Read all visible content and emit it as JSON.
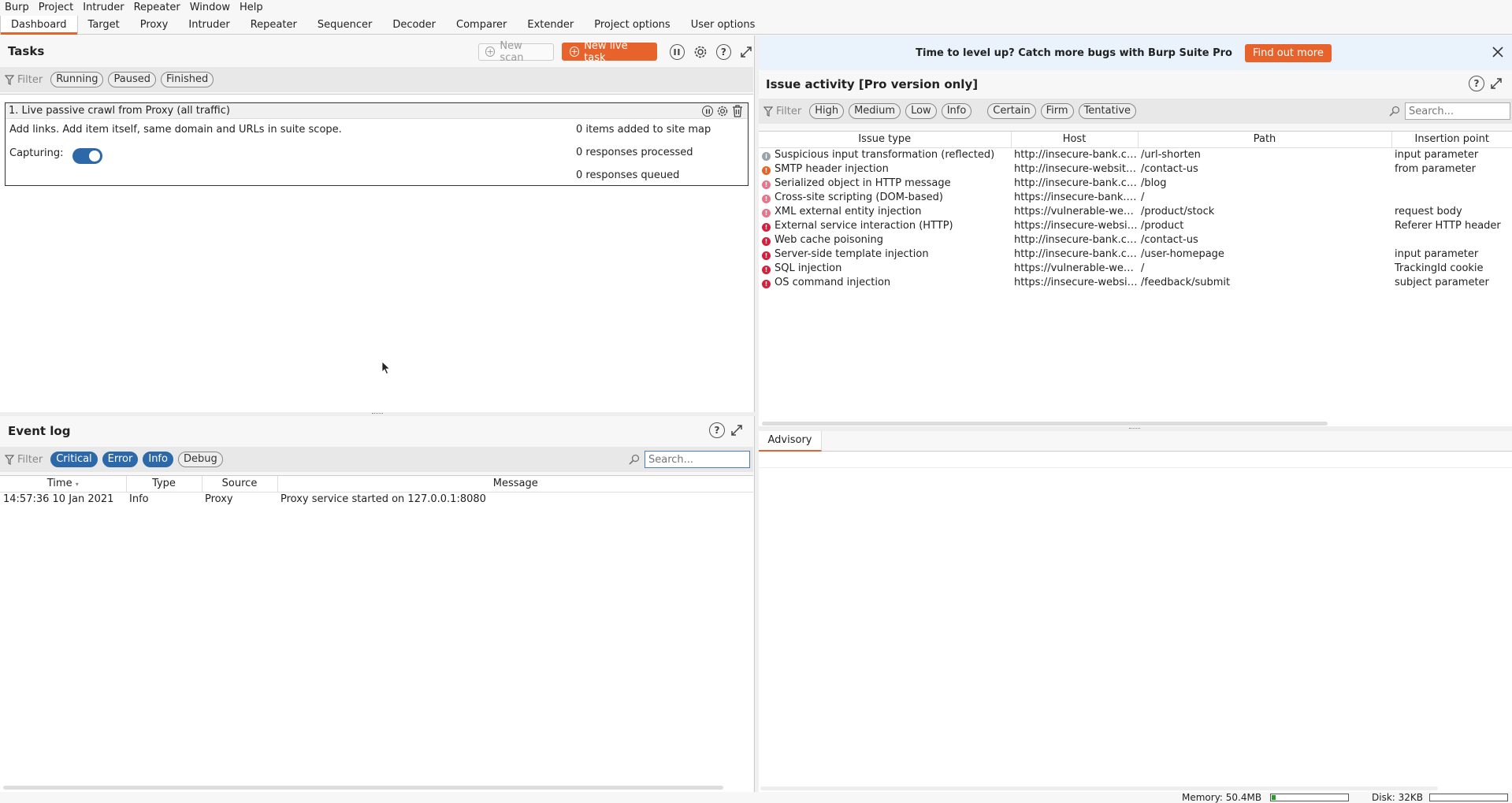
{
  "menu": [
    "Burp",
    "Project",
    "Intruder",
    "Repeater",
    "Window",
    "Help"
  ],
  "tabs": [
    "Dashboard",
    "Target",
    "Proxy",
    "Intruder",
    "Repeater",
    "Sequencer",
    "Decoder",
    "Comparer",
    "Extender",
    "Project options",
    "User options"
  ],
  "tasks": {
    "title": "Tasks",
    "new_scan": "New scan",
    "new_live_task": "New live task",
    "filter_label": "Filter",
    "filters": [
      "Running",
      "Paused",
      "Finished"
    ],
    "task": {
      "title": "1. Live passive crawl from Proxy (all traffic)",
      "description": "Add links. Add item itself, same domain and URLs in suite scope.",
      "capturing_label": "Capturing:",
      "stats": [
        "0 items added to site map",
        "0 responses processed",
        "0 responses queued"
      ]
    }
  },
  "event_log": {
    "title": "Event log",
    "filter_label": "Filter",
    "filters": [
      {
        "label": "Critical",
        "on": true
      },
      {
        "label": "Error",
        "on": true
      },
      {
        "label": "Info",
        "on": true
      },
      {
        "label": "Debug",
        "on": false
      }
    ],
    "search_placeholder": "Search...",
    "columns": [
      "Time",
      "Type",
      "Source",
      "Message"
    ],
    "rows": [
      {
        "time": "14:57:36 10 Jan 2021",
        "type": "Info",
        "source": "Proxy",
        "message": "Proxy service started on 127.0.0.1:8080"
      }
    ]
  },
  "banner": {
    "text": "Time to level up? Catch more bugs with Burp Suite Pro",
    "button": "Find out more"
  },
  "issues": {
    "title": "Issue activity [Pro version only]",
    "filter_label": "Filter",
    "severity_filters": [
      "High",
      "Medium",
      "Low",
      "Info"
    ],
    "confidence_filters": [
      "Certain",
      "Firm",
      "Tentative"
    ],
    "search_placeholder": "Search...",
    "columns": [
      "Issue type",
      "Host",
      "Path",
      "Insertion point"
    ],
    "rows": [
      {
        "severity": "info",
        "type": "Suspicious input transformation (reflected)",
        "host": "http://insecure-bank.com",
        "path": "/url-shorten",
        "insertion": "input parameter"
      },
      {
        "severity": "medium",
        "type": "SMTP header injection",
        "host": "http://insecure-website....",
        "path": "/contact-us",
        "insertion": "from parameter"
      },
      {
        "severity": "high-light",
        "type": "Serialized object in HTTP message",
        "host": "http://insecure-bank.com",
        "path": "/blog",
        "insertion": ""
      },
      {
        "severity": "high-light",
        "type": "Cross-site scripting (DOM-based)",
        "host": "https://insecure-bank.com",
        "path": "/",
        "insertion": ""
      },
      {
        "severity": "high-light",
        "type": "XML external entity injection",
        "host": "https://vulnerable-websi...",
        "path": "/product/stock",
        "insertion": "request body"
      },
      {
        "severity": "high",
        "type": "External service interaction (HTTP)",
        "host": "https://insecure-website...",
        "path": "/product",
        "insertion": "Referer HTTP header"
      },
      {
        "severity": "high",
        "type": "Web cache poisoning",
        "host": "http://insecure-bank.com",
        "path": "/contact-us",
        "insertion": ""
      },
      {
        "severity": "high",
        "type": "Server-side template injection",
        "host": "http://insecure-bank.com",
        "path": "/user-homepage",
        "insertion": "input parameter"
      },
      {
        "severity": "high",
        "type": "SQL injection",
        "host": "https://vulnerable-websi...",
        "path": "/",
        "insertion": "TrackingId cookie"
      },
      {
        "severity": "high",
        "type": "OS command injection",
        "host": "https://insecure-website...",
        "path": "/feedback/submit",
        "insertion": "subject parameter"
      }
    ]
  },
  "advisory_tab": "Advisory",
  "status": {
    "memory": "Memory: 50.4MB",
    "memory_fraction": 0.05,
    "disk": "Disk: 32KB",
    "disk_fraction": 0.0
  },
  "colors": {
    "accent": "#e8632b",
    "chip_on": "#2d68a8",
    "severity_high": "#d81e3a",
    "severity_high_light": "#e8748a",
    "severity_medium": "#e8632b",
    "severity_info": "#9aa3aa",
    "memory_bar": "#1fa31f"
  }
}
